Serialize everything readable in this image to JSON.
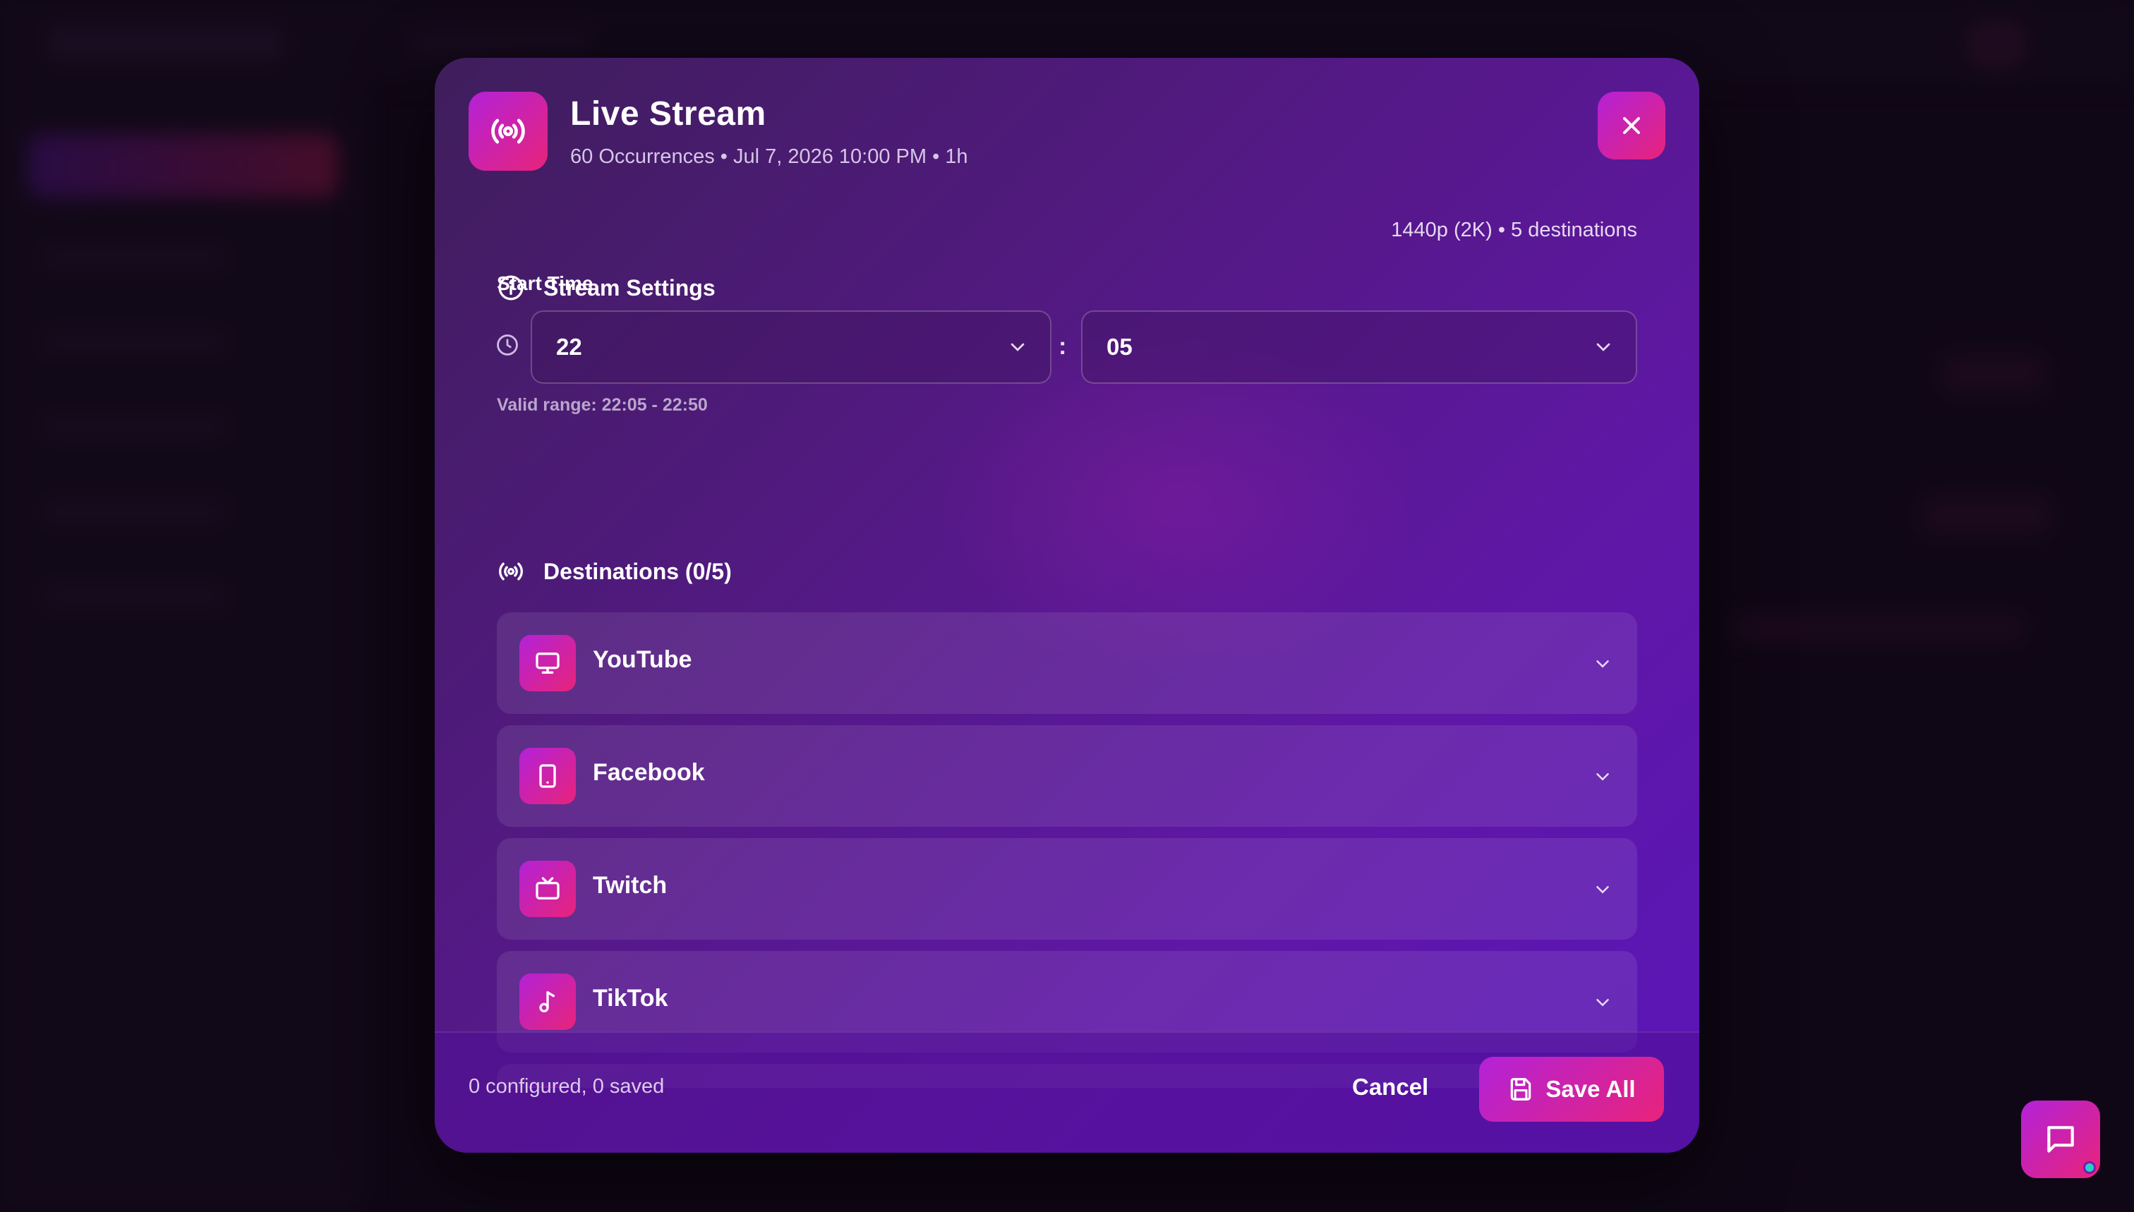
{
  "modal": {
    "title": "Live Stream",
    "subtitle": "60 Occurrences • Jul 7, 2026 10:00 PM • 1h",
    "head_icon": "broadcast-icon",
    "close_icon": "close-icon"
  },
  "stream_settings": {
    "title": "Stream Settings",
    "meta": "1440p (2K) • 5 destinations",
    "start_time_label": "Start Time",
    "hour": "22",
    "minute": "05",
    "separator": ":",
    "valid_range": "Valid range: 22:05 - 22:50"
  },
  "destinations": {
    "title": "Destinations (0/5)",
    "items": [
      {
        "label": "YouTube",
        "icon": "monitor-icon"
      },
      {
        "label": "Facebook",
        "icon": "tablet-icon"
      },
      {
        "label": "Twitch",
        "icon": "tv-icon"
      },
      {
        "label": "TikTok",
        "icon": "music-note-icon"
      }
    ]
  },
  "footer": {
    "status": "0 configured, 0 saved",
    "cancel_label": "Cancel",
    "save_label": "Save All"
  },
  "colors": {
    "accent_start": "#b322d8",
    "accent_end": "#e8237a",
    "modal_bg": "#5617a0"
  }
}
